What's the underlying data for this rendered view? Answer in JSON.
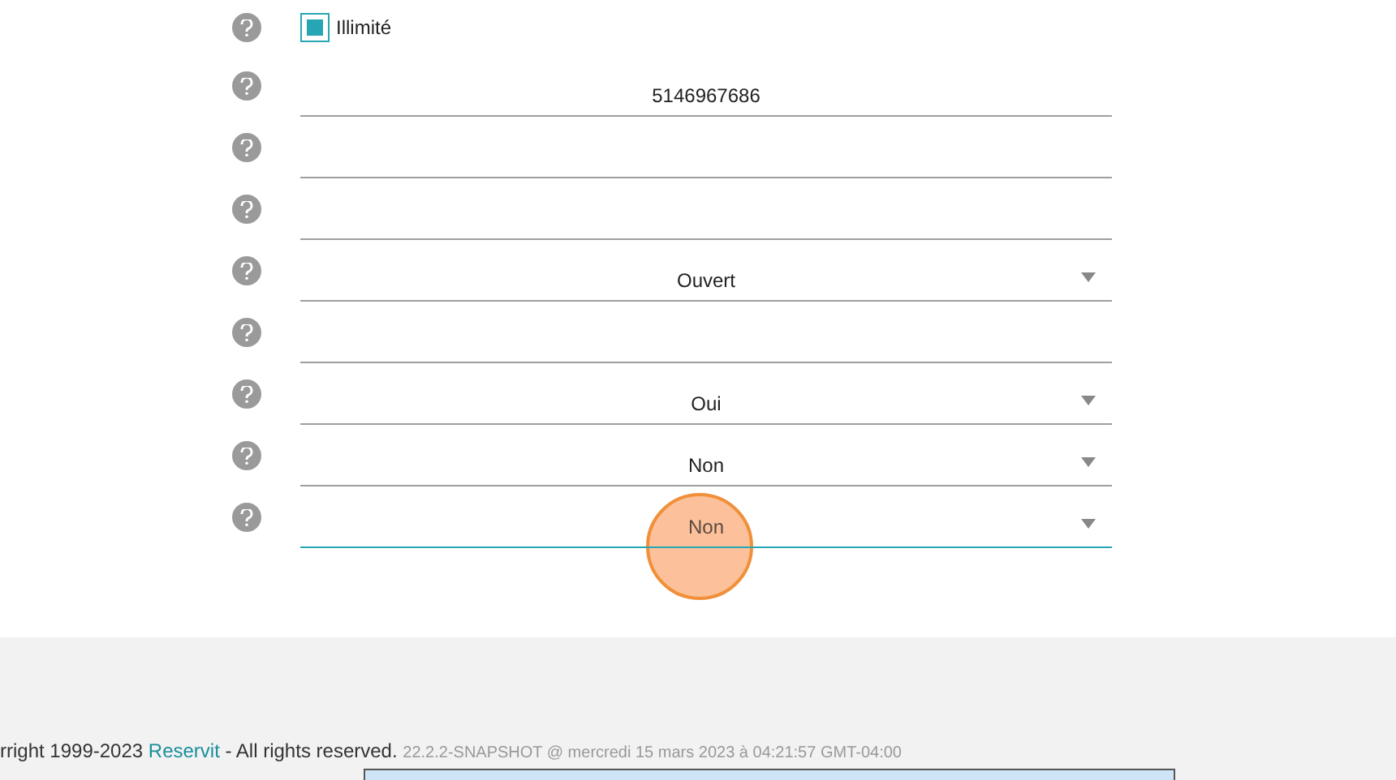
{
  "form_rows": [
    {
      "kind": "checkbox",
      "label": "Illimité",
      "checked": true
    },
    {
      "kind": "text",
      "value": "5146967686"
    },
    {
      "kind": "text",
      "value": ""
    },
    {
      "kind": "text",
      "value": ""
    },
    {
      "kind": "select",
      "value": "Ouvert",
      "focused": false
    },
    {
      "kind": "text",
      "value": ""
    },
    {
      "kind": "select",
      "value": "Oui",
      "focused": false
    },
    {
      "kind": "select",
      "value": "Non",
      "focused": false
    },
    {
      "kind": "select",
      "value": "Non",
      "focused": true
    }
  ],
  "footer": {
    "copyright_before": "rright 1999-2023",
    "link": "Reservit",
    "copyright_after": "- All rights reserved.",
    "version": "22.2.2-SNAPSHOT @ mercredi 15 mars 2023 à 04:21:57 GMT-04:00"
  }
}
